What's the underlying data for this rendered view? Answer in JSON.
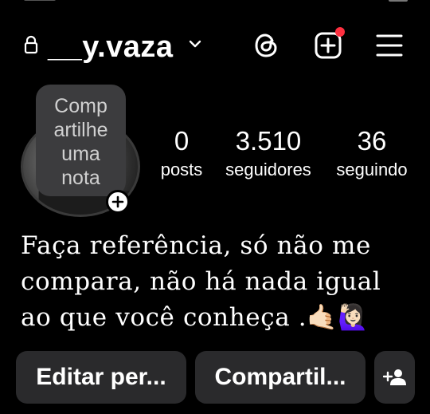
{
  "header": {
    "username": "__y.vaza"
  },
  "note": {
    "lines": [
      "Comp",
      "artilhe",
      "uma",
      "nota"
    ]
  },
  "stats": {
    "posts": {
      "value": "0",
      "label": "posts"
    },
    "followers": {
      "value": "3.510",
      "label": "seguidores"
    },
    "following": {
      "value": "36",
      "label": "seguindo"
    }
  },
  "bio": {
    "text": "Faça referência, só não me compara, não há nada igual ao que você conheça .🤙🏻🙋🏻‍♀️"
  },
  "actions": {
    "edit_label": "Editar per...",
    "share_label": "Compartil..."
  },
  "colors": {
    "background": "#000000",
    "button_bg": "#2a2a2c",
    "note_bg": "#3c3c3e",
    "notification_dot": "#ff3040"
  },
  "icons": {
    "lock": "lock-icon",
    "chevron": "chevron-down-icon",
    "threads": "threads-icon",
    "create": "add-square-icon",
    "menu": "hamburger-menu-icon",
    "add_note": "plus-icon",
    "discover": "add-person-icon"
  }
}
